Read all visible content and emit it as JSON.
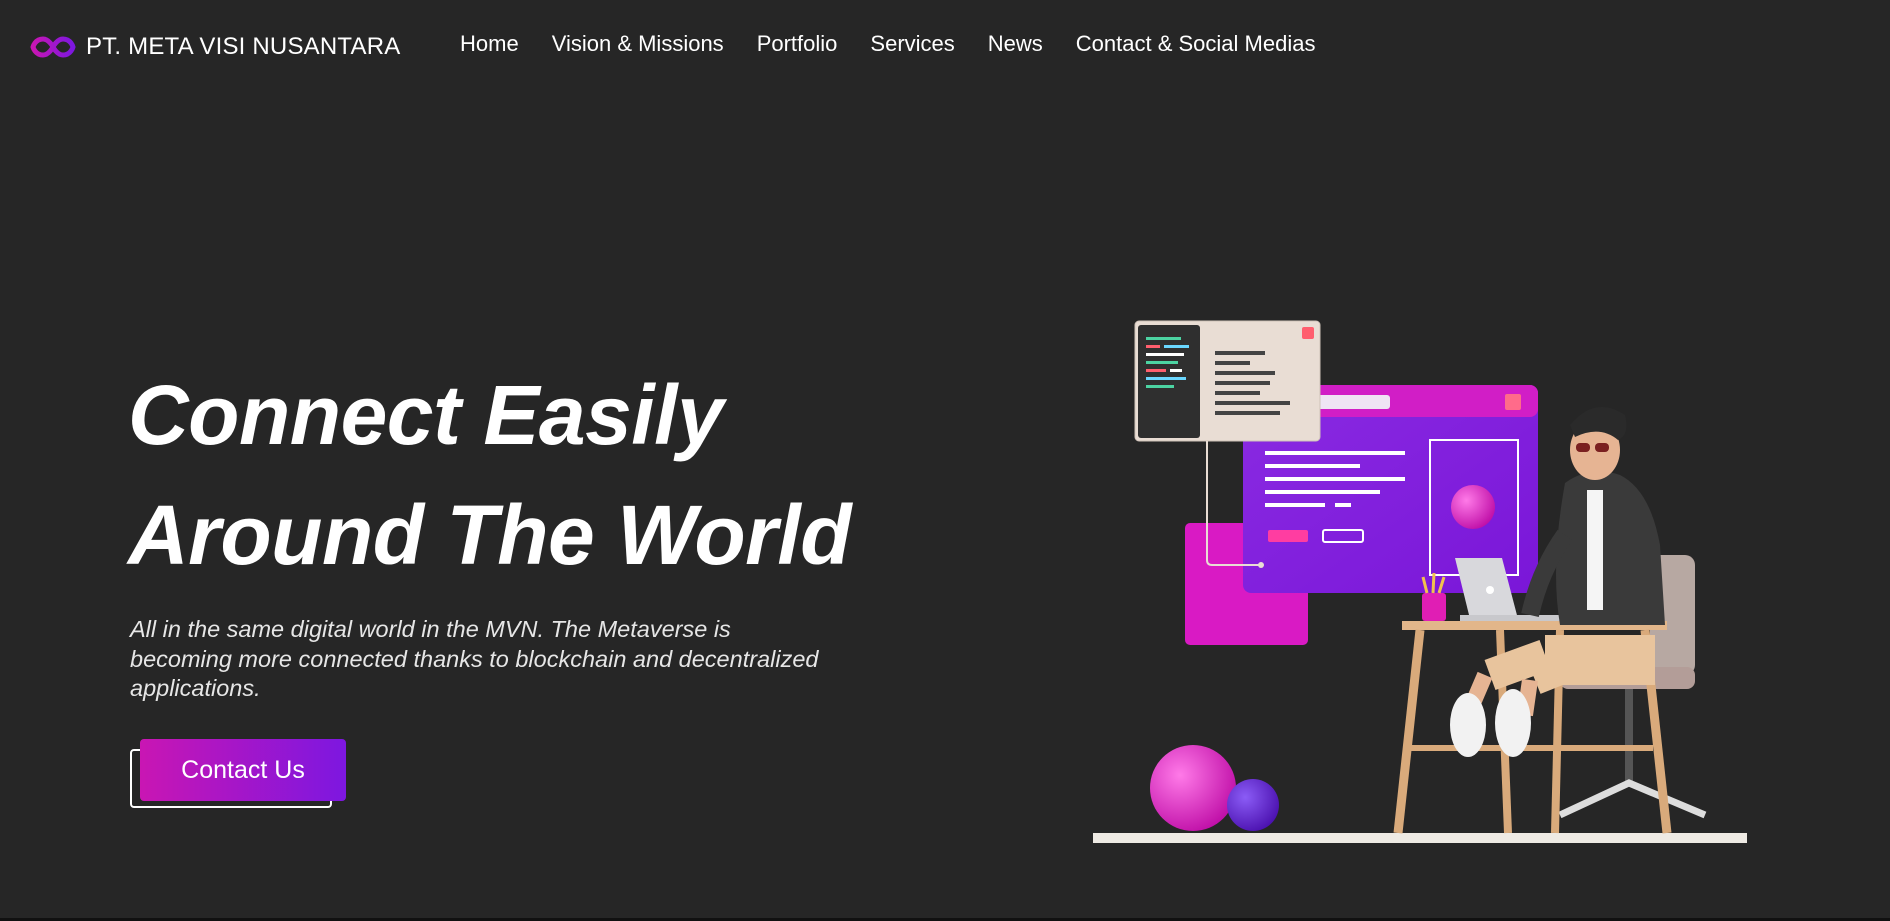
{
  "nav": {
    "brand": "PT. META VISI NUSANTARA",
    "logo_icon": "infinity-logo-icon",
    "items": [
      {
        "label": "Home"
      },
      {
        "label": "Vision & Missions"
      },
      {
        "label": "Portfolio"
      },
      {
        "label": "Services"
      },
      {
        "label": "News"
      },
      {
        "label": "Contact & Social Medias"
      }
    ]
  },
  "hero": {
    "title_line1": "Connect Easily",
    "title_line2": "Around The World",
    "subtitle": "All in the same digital world in the MVN. The Metaverse is becoming more connected thanks to blockchain and decentralized applications.",
    "cta_label": "Contact Us",
    "illustration": "person-working-on-laptop-with-ui-windows-illustration"
  },
  "colors": {
    "background": "#262626",
    "accent_magenta": "#c916b3",
    "accent_purple": "#7d17e0",
    "text": "#ffffff"
  }
}
